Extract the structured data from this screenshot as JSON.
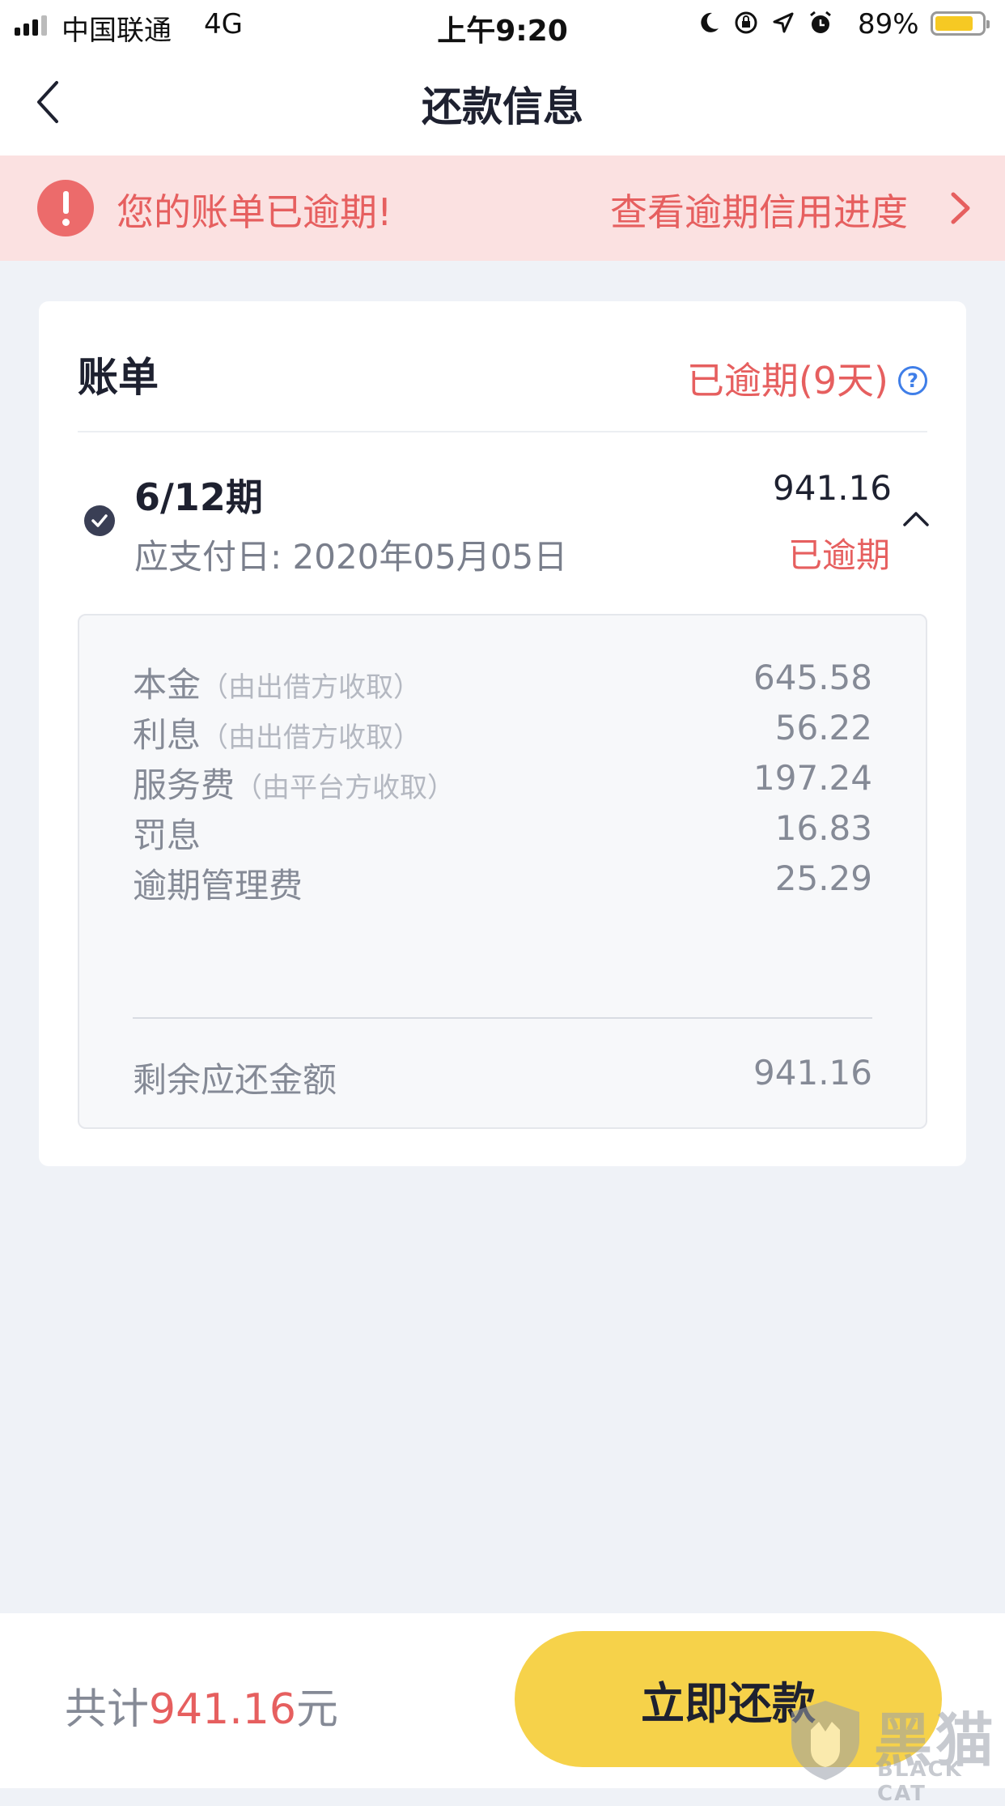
{
  "status_bar": {
    "carrier": "中国联通",
    "network": "4G",
    "time": "上午9:20",
    "battery_pct": "89%",
    "battery_level": 0.89,
    "icons": [
      "moon-icon",
      "rotation-lock-icon",
      "location-icon",
      "alarm-icon"
    ]
  },
  "nav": {
    "title": "还款信息",
    "back_icon": "chevron-left-icon"
  },
  "alert": {
    "message": "您的账单已逾期!",
    "link": "查看逾期信用进度",
    "icon": "exclamation-icon",
    "color": "#e65f5f"
  },
  "bill": {
    "title": "账单",
    "overdue_status": "已逾期(9天)",
    "help": "?",
    "period": {
      "label": "6/12期",
      "due_date": "应支付日: 2020年05月05日",
      "amount": "941.16",
      "status": "已逾期"
    },
    "details": [
      {
        "label": "本金",
        "note": "（由出借方收取）",
        "value": "645.58"
      },
      {
        "label": "利息",
        "note": "（由出借方收取）",
        "value": "56.22"
      },
      {
        "label": "服务费",
        "note": "（由平台方收取）",
        "value": "197.24"
      },
      {
        "label": "罚息",
        "note": "",
        "value": "16.83"
      },
      {
        "label": "逾期管理费",
        "note": "",
        "value": "25.29"
      }
    ],
    "remaining": {
      "label": "剩余应还金额",
      "value": "941.16"
    }
  },
  "footer": {
    "total_prefix": "共计",
    "total_amount": "941.16",
    "total_suffix": "元",
    "pay_button": "立即还款",
    "button_color": "#f6d24a"
  },
  "watermark": {
    "text": "黑猫",
    "sub": "BLACK CAT"
  }
}
